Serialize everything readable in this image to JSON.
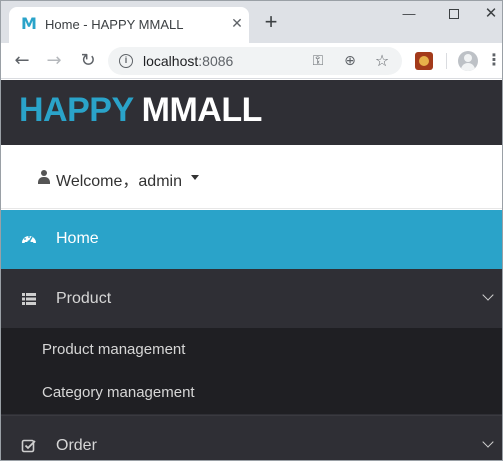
{
  "browser": {
    "tab_favicon": "M",
    "tab_title": "Home - HAPPY MMALL",
    "close_glyph": "✕",
    "new_tab_glyph": "+",
    "url_host": "localhost",
    "url_port": ":8086"
  },
  "site": {
    "logo_part1": "HAPPY",
    "logo_part2": "MMALL",
    "welcome": "Welcome，admin",
    "colors": {
      "accent": "#2aa3c9",
      "dark": "#2f2f35",
      "submenu": "#1f1f23"
    }
  },
  "sidebar": {
    "items": [
      {
        "label": "Home",
        "icon": "dashboard-icon",
        "active": true
      },
      {
        "label": "Product",
        "icon": "list-icon",
        "expanded": true,
        "children": [
          {
            "label": "Product management"
          },
          {
            "label": "Category management"
          }
        ]
      },
      {
        "label": "Order",
        "icon": "check-square-icon",
        "expanded": false
      }
    ]
  }
}
